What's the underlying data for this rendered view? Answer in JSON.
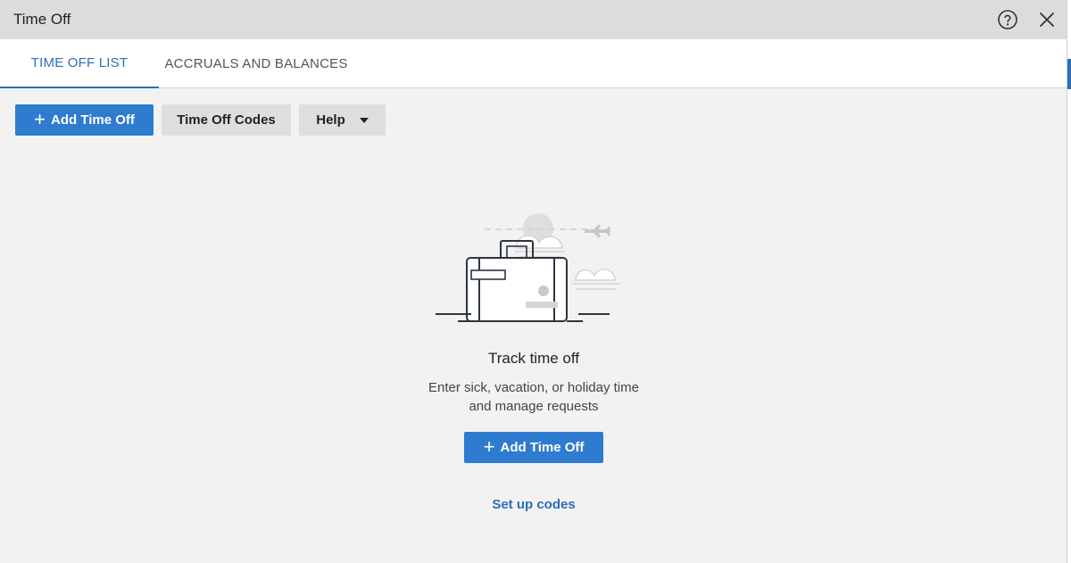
{
  "window": {
    "title": "Time Off"
  },
  "tabs": [
    {
      "label": "TIME OFF LIST",
      "active": true
    },
    {
      "label": "ACCRUALS AND BALANCES",
      "active": false
    }
  ],
  "toolbar": {
    "add_label": "Add Time Off",
    "codes_label": "Time Off Codes",
    "help_label": "Help"
  },
  "empty_state": {
    "title": "Track time off",
    "description_line1": "Enter sick, vacation, or holiday time",
    "description_line2": "and manage requests",
    "add_label": "Add Time Off",
    "link_label": "Set up codes"
  },
  "icons": {
    "help": "question-circle-icon",
    "close": "close-icon",
    "plus": "plus-icon",
    "dropdown": "caret-down-icon"
  },
  "colors": {
    "accent": "#2f7bd0",
    "link": "#2b6fb6",
    "titlebar": "#dcdcdc",
    "background": "#f2f2f2"
  }
}
